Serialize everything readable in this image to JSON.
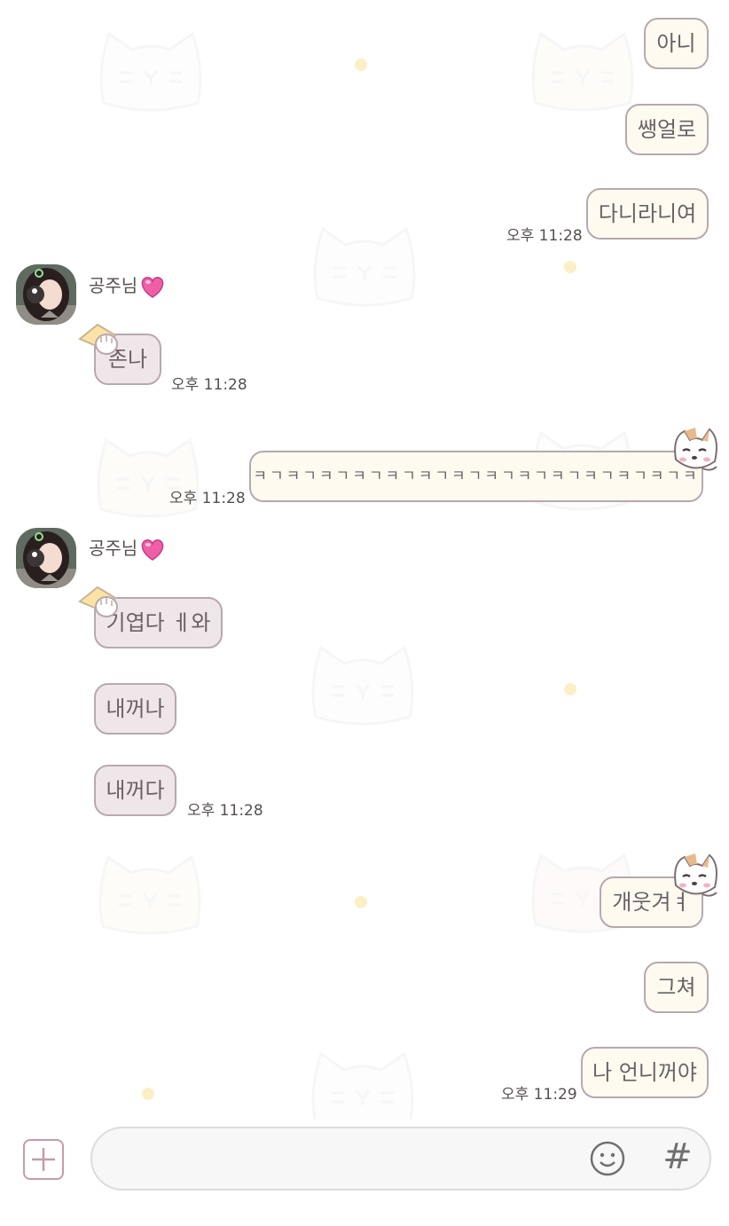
{
  "colors": {
    "bubble_me": "#fffaf0",
    "bubble_them": "#efe6e9",
    "bubble_border": "#b8a8ae",
    "accent_plus": "#c79ba8"
  },
  "messages": [
    {
      "side": "me",
      "text": "아니"
    },
    {
      "side": "me",
      "text": "쌩얼로"
    },
    {
      "side": "me",
      "text": "다니라니여",
      "time": "오후 11:28"
    },
    {
      "sender": "공주님",
      "side": "them",
      "text": "존나",
      "time": "오후 11:28"
    },
    {
      "side": "me",
      "text": "ㅋㄱㅋㄱㅋㄱㅋㄱㅋㄱㅋㄱㅋㄱㅋㄱㅋㄱㅋㄱㅋㄱㅋㄱㅋㄱㅋ",
      "time": "오후 11:28"
    },
    {
      "sender": "공주님",
      "side": "them",
      "text": "기엽다 ㅔ와"
    },
    {
      "side": "them",
      "text": "내꺼나"
    },
    {
      "side": "them",
      "text": "내꺼다",
      "time": "오후 11:28"
    },
    {
      "side": "me",
      "text": "개웃겨ㅕ"
    },
    {
      "side": "me",
      "text": "그쳐"
    },
    {
      "side": "me",
      "text": "나 언니꺼야",
      "time": "오후 11:29"
    }
  ],
  "input_bar": {
    "placeholder": "",
    "plus_icon": "plus-icon",
    "emoji_icon": "emoji-icon",
    "hash_label": "#"
  }
}
